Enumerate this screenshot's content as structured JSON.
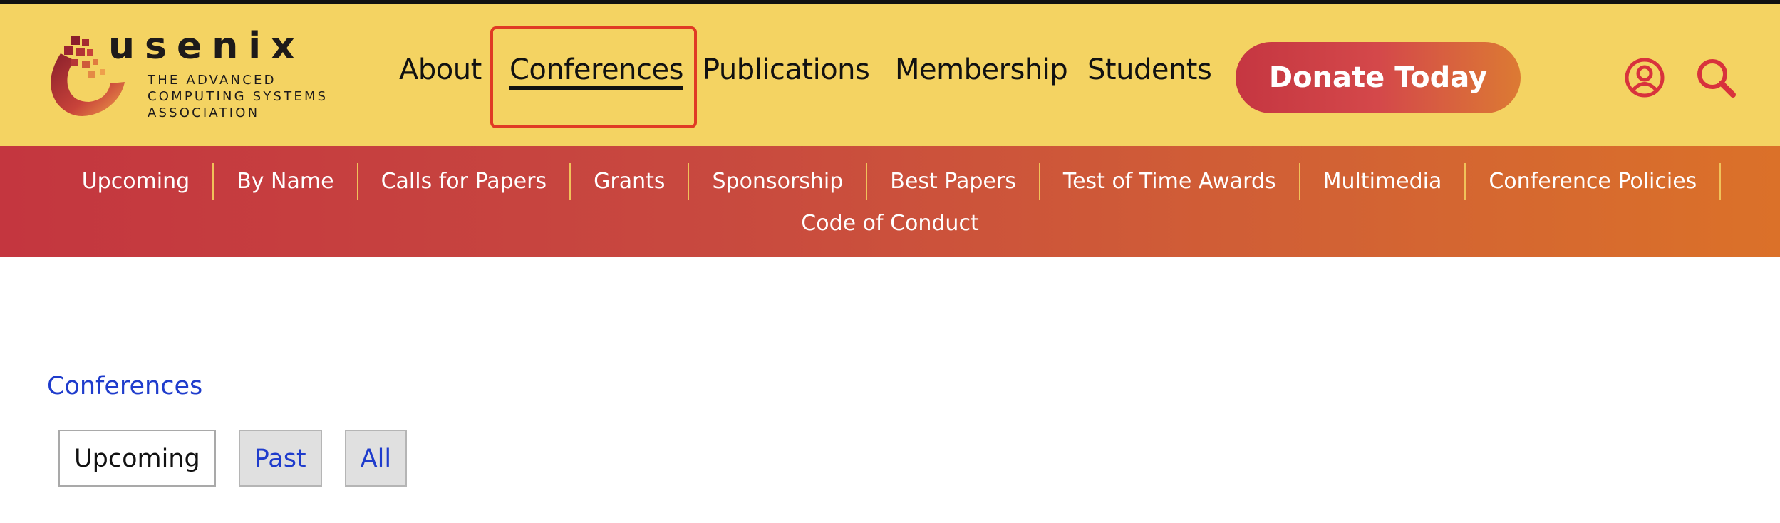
{
  "header": {
    "logo_word": "usenix",
    "logo_tagline": [
      "THE ADVANCED",
      "COMPUTING SYSTEMS",
      "ASSOCIATION"
    ]
  },
  "primary_nav": [
    {
      "label": "About",
      "active": false
    },
    {
      "label": "Conferences",
      "active": true
    },
    {
      "label": "Publications",
      "active": false
    },
    {
      "label": "Membership",
      "active": false
    },
    {
      "label": "Students",
      "active": false
    }
  ],
  "donate_label": "Donate Today",
  "icons": {
    "account": "user-circle-icon",
    "search": "search-icon"
  },
  "sub_nav": {
    "row1": [
      "Upcoming",
      "By Name",
      "Calls for Papers",
      "Grants",
      "Sponsorship",
      "Best Papers",
      "Test of Time Awards",
      "Multimedia",
      "Conference Policies"
    ],
    "row2": [
      "Code of Conduct"
    ]
  },
  "breadcrumb": "Conferences",
  "filter_tabs": [
    {
      "label": "Upcoming",
      "active": true
    },
    {
      "label": "Past",
      "active": false
    },
    {
      "label": "All",
      "active": false
    }
  ],
  "colors": {
    "header_bg": "#f4d362",
    "accent_red": "#c53641",
    "accent_orange": "#dc7a33",
    "link_blue": "#1f3ccc",
    "highlight_outline": "#e03a24"
  }
}
